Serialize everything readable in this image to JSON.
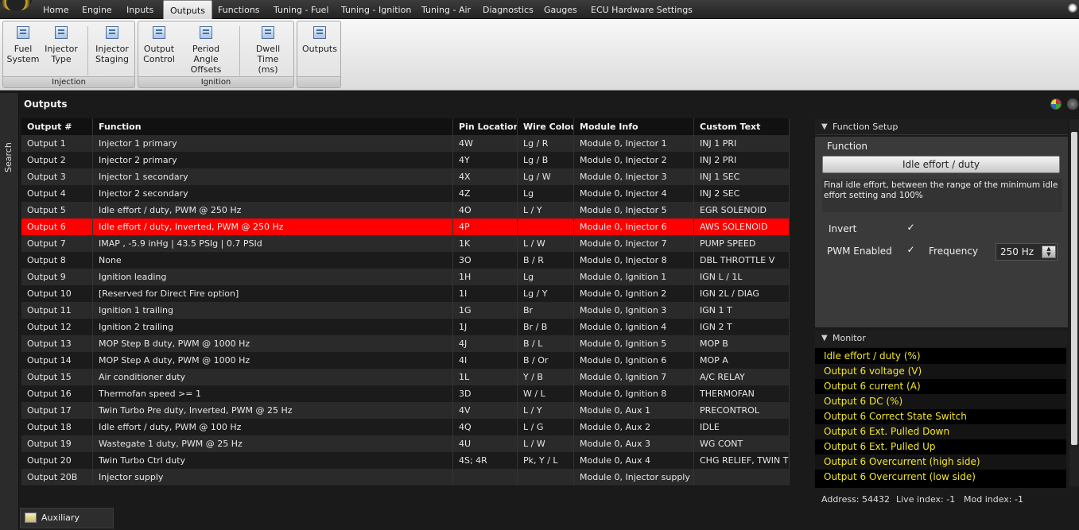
{
  "menu": {
    "tabs": [
      "Home",
      "Engine",
      "Inputs",
      "Outputs",
      "Functions",
      "Tuning - Fuel",
      "Tuning - Ignition",
      "Tuning - Air",
      "Diagnostics",
      "Gauges",
      "ECU Hardware Settings"
    ],
    "active_tab": "Outputs"
  },
  "ribbon": {
    "injection": {
      "label": "Injection",
      "buttons": [
        {
          "label": "Fuel\nSystem"
        },
        {
          "label": "Injector\nType"
        },
        {
          "label": "Injector\nStaging"
        }
      ]
    },
    "ignition": {
      "label": "Ignition",
      "buttons": [
        {
          "label": "Output\nControl"
        },
        {
          "label": "Period Angle\nOffsets"
        },
        {
          "label": "Dwell Time\n(ms)"
        }
      ]
    },
    "outputs": {
      "label": "",
      "buttons": [
        {
          "label": "Outputs"
        }
      ]
    }
  },
  "sidebar": {
    "search_label": "Search"
  },
  "panel": {
    "title": "Outputs"
  },
  "grid": {
    "columns": [
      "Output #",
      "Function",
      "Pin Location",
      "Wire Colour",
      "Module Info",
      "Custom Text"
    ],
    "selected_index": 5,
    "rows": [
      [
        "Output 1",
        "Injector 1 primary",
        "4W",
        "Lg / R",
        "Module 0, Injector 1",
        "INJ 1 PRI"
      ],
      [
        "Output 2",
        "Injector 2 primary",
        "4Y",
        "Lg / B",
        "Module 0, Injector 2",
        "INJ 2 PRI"
      ],
      [
        "Output 3",
        "Injector 1 secondary",
        "4X",
        "Lg / W",
        "Module 0, Injector 3",
        "INJ 1 SEC"
      ],
      [
        "Output 4",
        "Injector 2 secondary",
        "4Z",
        "Lg",
        "Module 0, Injector 4",
        "INJ 2 SEC"
      ],
      [
        "Output 5",
        "Idle effort / duty, PWM @ 250 Hz",
        "4O",
        "L / Y",
        "Module 0, Injector 5",
        "EGR SOLENOID"
      ],
      [
        "Output 6",
        "Idle effort / duty, Inverted, PWM @ 250 Hz",
        "4P",
        "",
        "Module 0, Injector 6",
        "AWS SOLENOID"
      ],
      [
        "Output 7",
        "IMAP , -5.9 inHg | 43.5 PSIg | 0.7 PSId",
        "1K",
        "L / W",
        "Module 0, Injector 7",
        "PUMP SPEED"
      ],
      [
        "Output 8",
        "None",
        "3O",
        "B / R",
        "Module 0, Injector 8",
        "DBL THROTTLE V"
      ],
      [
        "Output 9",
        "Ignition leading",
        "1H",
        "Lg",
        "Module 0, Ignition 1",
        "IGN L / 1L"
      ],
      [
        "Output 10",
        "[Reserved for Direct Fire option]",
        "1I",
        "Lg / Y",
        "Module 0, Ignition 2",
        "IGN 2L / DIAG"
      ],
      [
        "Output 11",
        "Ignition 1 trailing",
        "1G",
        "Br",
        "Module 0, Ignition 3",
        "IGN 1 T"
      ],
      [
        "Output 12",
        "Ignition 2 trailing",
        "1J",
        "Br / B",
        "Module 0, Ignition 4",
        "IGN 2 T"
      ],
      [
        "Output 13",
        "MOP Step B duty, PWM @ 1000 Hz",
        "4J",
        "B / L",
        "Module 0, Ignition 5",
        "MOP B"
      ],
      [
        "Output 14",
        "MOP Step A duty, PWM @ 1000 Hz",
        "4I",
        "B / Or",
        "Module 0, Ignition 6",
        "MOP A"
      ],
      [
        "Output 15",
        "Air conditioner duty",
        "1L",
        "Y / B",
        "Module 0, Ignition 7",
        "A/C RELAY"
      ],
      [
        "Output 16",
        "Thermofan speed >= 1",
        "3D",
        "W / L",
        "Module 0, Ignition 8",
        "THERMOFAN"
      ],
      [
        "Output 17",
        "Twin Turbo Pre duty, Inverted, PWM @ 25 Hz",
        "4V",
        "L / Y",
        "Module 0, Aux 1",
        "PRECONTROL"
      ],
      [
        "Output 18",
        "Idle effort / duty, PWM @ 100 Hz",
        "4Q",
        "L / G",
        "Module 0, Aux 2",
        "IDLE"
      ],
      [
        "Output 19",
        "Wastegate 1 duty, PWM @ 25 Hz",
        "4U",
        "L / W",
        "Module 0, Aux 3",
        "WG CONT"
      ],
      [
        "Output 20",
        "Twin Turbo Ctrl duty",
        "4S; 4R",
        "Pk, Y / L",
        "Module 0, Aux 4",
        "CHG RELIEF, TWIN TURBO"
      ],
      [
        "Output 20B",
        "Injector supply",
        "",
        "",
        "Module 0, Injector supply",
        ""
      ]
    ]
  },
  "function_setup": {
    "header": "Function Setup",
    "section_label": "Function",
    "function_button": "Idle effort / duty",
    "description": "Final idle effort, between the range of the minimum idle effort setting and 100%",
    "invert_label": "Invert",
    "invert_checked": true,
    "pwm_label": "PWM Enabled",
    "pwm_checked": true,
    "frequency_label": "Frequency",
    "frequency_value": "250 Hz"
  },
  "monitor": {
    "header": "Monitor",
    "items": [
      "Idle effort / duty (%)",
      "Output 6 voltage (V)",
      "Output 6 current (A)",
      "Output 6  DC (%)",
      "Output 6 Correct State Switch",
      "Output 6 Ext. Pulled Down",
      "Output 6 Ext. Pulled Up",
      "Output 6  Overcurrent (high side)",
      "Output 6  Overcurrent (low side)"
    ]
  },
  "status": {
    "address": "Address: 54432",
    "live_index": "Live index: -1",
    "mod_index": "Mod index: -1"
  },
  "bottom_tabs": {
    "aux_outputs": "Auxiliary Outputs"
  },
  "colors": {
    "selected_row": "#ff0000",
    "monitor_text": "#f2e62a"
  }
}
